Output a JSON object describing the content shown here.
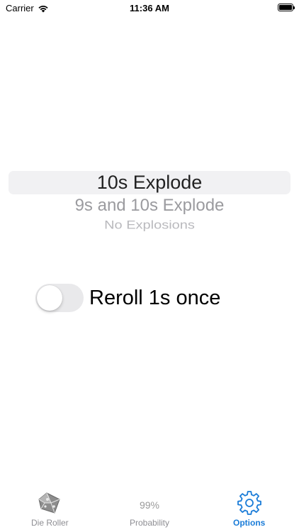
{
  "status_bar": {
    "carrier": "Carrier",
    "time": "11:36 AM",
    "icons": [
      "wifi-icon",
      "battery-icon"
    ]
  },
  "picker": {
    "options": [
      "10s Explode",
      "9s and 10s Explode",
      "No Explosions"
    ],
    "selected": "10s Explode"
  },
  "reroll_toggle": {
    "label": "Reroll 1s once",
    "on": false
  },
  "tab_bar": {
    "active_color": "#1a7cd8",
    "inactive_color": "#8e8e93",
    "tabs": [
      {
        "label": "Die Roller",
        "icon": "d10-die-icon",
        "active": false
      },
      {
        "label": "Probability",
        "icon_text": "99%",
        "active": false
      },
      {
        "label": "Options",
        "icon": "gear-icon",
        "active": true
      }
    ]
  }
}
